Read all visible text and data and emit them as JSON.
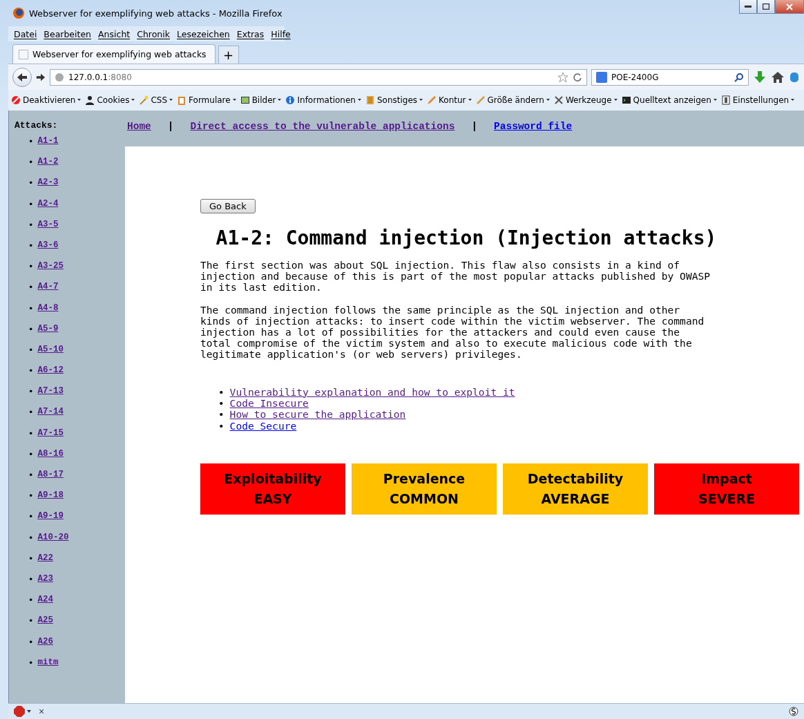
{
  "window": {
    "title": "Webserver for exemplifying web attacks - Mozilla Firefox"
  },
  "menu": [
    "Datei",
    "Bearbeiten",
    "Ansicht",
    "Chronik",
    "Lesezeichen",
    "Extras",
    "Hilfe"
  ],
  "tabs": [
    {
      "label": "Webserver for exemplifying web attacks",
      "selected": true
    }
  ],
  "new_tab": "+",
  "address": {
    "host": "127.0.0.1",
    "port": ":8080"
  },
  "search": {
    "value": "POE-2400G"
  },
  "toolbar": [
    {
      "label": "Deaktivieren",
      "kind": "forbid"
    },
    {
      "label": "Cookies",
      "kind": "person"
    },
    {
      "label": "CSS",
      "kind": "wand"
    },
    {
      "label": "Formulare",
      "kind": "clipboard"
    },
    {
      "label": "Bilder",
      "kind": "image"
    },
    {
      "label": "Informationen",
      "kind": "info"
    },
    {
      "label": "Sonstiges",
      "kind": "book"
    },
    {
      "label": "Kontur",
      "kind": "pencil"
    },
    {
      "label": "Größe ändern",
      "kind": "ruler"
    },
    {
      "label": "Werkzeuge",
      "kind": "tools"
    },
    {
      "label": "Quelltext anzeigen",
      "kind": "terminal"
    },
    {
      "label": "Einstellungen",
      "kind": "switch"
    }
  ],
  "sidebar": {
    "heading": "Attacks:",
    "items": [
      {
        "label": "A1-1",
        "visited": true
      },
      {
        "label": "A1-2",
        "visited": true
      },
      {
        "label": "A2-3",
        "visited": true
      },
      {
        "label": "A2-4",
        "visited": true
      },
      {
        "label": "A3-5",
        "visited": true
      },
      {
        "label": "A3-6",
        "visited": true
      },
      {
        "label": "A3-25",
        "visited": true
      },
      {
        "label": "A4-7",
        "visited": true
      },
      {
        "label": "A4-8",
        "visited": true
      },
      {
        "label": "A5-9",
        "visited": true
      },
      {
        "label": "A5-10",
        "visited": true
      },
      {
        "label": "A6-12",
        "visited": true
      },
      {
        "label": "A7-13",
        "visited": true
      },
      {
        "label": "A7-14",
        "visited": true
      },
      {
        "label": "A7-15",
        "visited": true
      },
      {
        "label": "A8-16",
        "visited": true
      },
      {
        "label": "A8-17",
        "visited": true
      },
      {
        "label": "A9-18",
        "visited": true
      },
      {
        "label": "A9-19",
        "visited": true
      },
      {
        "label": "A10-20",
        "visited": true
      },
      {
        "label": "A22",
        "visited": true
      },
      {
        "label": "A23",
        "visited": true
      },
      {
        "label": "A24",
        "visited": true
      },
      {
        "label": "A25",
        "visited": true
      },
      {
        "label": "A26",
        "visited": true
      },
      {
        "label": "mitm",
        "visited": true
      }
    ]
  },
  "top_nav": [
    {
      "label": "Home",
      "visited": true
    },
    {
      "label": "Direct access to the vulnerable applications",
      "visited": true
    },
    {
      "label": "Password file",
      "visited": false
    }
  ],
  "nav_separator": "|",
  "bullet": "•",
  "go_back_button": "Go Back",
  "heading": "A1-2: Command injection (Injection attacks)",
  "paragraphs": [
    "The first section was about SQL injection. This flaw also consists in a kind of injection and because of this is part of the most popular attacks published by OWASP in its last edition.",
    "The command injection follows the same principle as the SQL injection and other kinds of injection attacks: to insert code within the victim webserver. The command injection has a lot of possibilities for the attackers and could even cause the total compromise of the victim system and also to execute malicious code with the legitimate application's (or web servers) privileges."
  ],
  "links": [
    {
      "label": "Vulnerability explanation and how to exploit it",
      "visited": true
    },
    {
      "label": "Code Insecure",
      "visited": true
    },
    {
      "label": "How to secure the application",
      "visited": true
    },
    {
      "label": "Code Secure",
      "visited": false
    }
  ],
  "ratings": [
    {
      "label": "Exploitability",
      "value": "EASY",
      "color": "#ff0000"
    },
    {
      "label": "Prevalence",
      "value": "COMMON",
      "color": "#ffc000"
    },
    {
      "label": "Detectability",
      "value": "AVERAGE",
      "color": "#ffc000"
    },
    {
      "label": "Impact",
      "value": "SEVERE",
      "color": "#ff0000"
    }
  ],
  "status_bar": {
    "close": "×"
  }
}
